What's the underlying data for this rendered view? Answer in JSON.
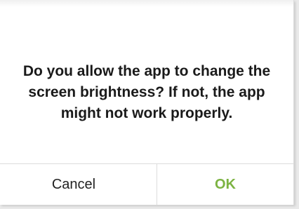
{
  "dialog": {
    "message": "Do you allow the app to change the screen brightness? If not, the app might not work properly.",
    "cancel_label": "Cancel",
    "ok_label": "OK"
  },
  "colors": {
    "ok_accent": "#7cb342",
    "text": "#1a1a1a",
    "background": "#ffffff"
  }
}
